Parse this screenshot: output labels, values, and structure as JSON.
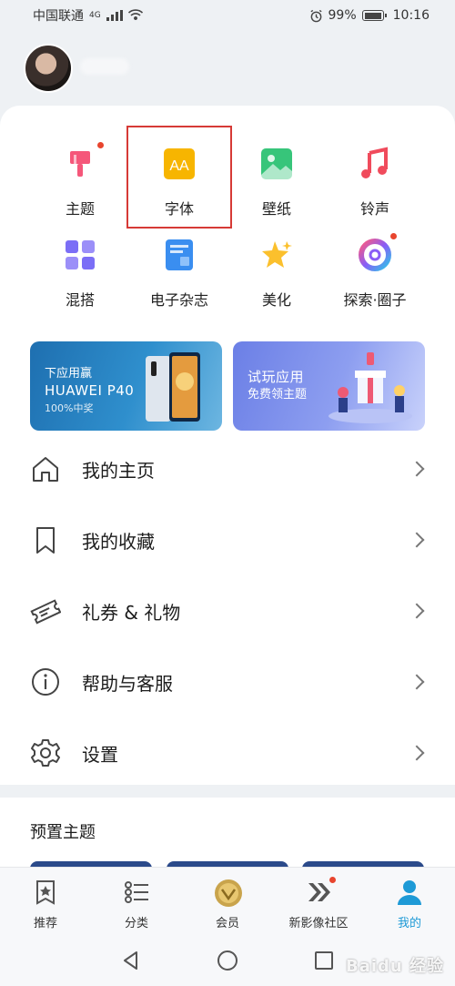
{
  "status_bar": {
    "carrier": "中国联通",
    "network": "4G",
    "battery": "99%",
    "time": "10:16"
  },
  "grid": {
    "items": [
      {
        "label": "主题",
        "icon": "brush-icon"
      },
      {
        "label": "字体",
        "icon": "font-icon"
      },
      {
        "label": "壁纸",
        "icon": "wallpaper-icon"
      },
      {
        "label": "铃声",
        "icon": "music-note-icon"
      },
      {
        "label": "混搭",
        "icon": "mix-grid-icon"
      },
      {
        "label": "电子杂志",
        "icon": "magazine-icon"
      },
      {
        "label": "美化",
        "icon": "star-icon"
      },
      {
        "label": "探索·圈子",
        "icon": "explore-circle-icon"
      }
    ]
  },
  "banners": {
    "left": {
      "line1": "下应用赢",
      "line2": "HUAWEI P40",
      "line3": "100%中奖"
    },
    "right": {
      "line1": "试玩应用",
      "line2": "免费领主题"
    }
  },
  "menu": {
    "items": [
      {
        "label": "我的主页",
        "icon": "home-icon"
      },
      {
        "label": "我的收藏",
        "icon": "bookmark-icon"
      },
      {
        "label": "礼券 & 礼物",
        "icon": "ticket-icon"
      },
      {
        "label": "帮助与客服",
        "icon": "info-icon"
      },
      {
        "label": "设置",
        "icon": "gear-icon"
      }
    ]
  },
  "preset_section": {
    "title": "预置主题"
  },
  "tabbar": {
    "items": [
      {
        "label": "推荐",
        "icon": "star-bookmark-icon"
      },
      {
        "label": "分类",
        "icon": "list-icon"
      },
      {
        "label": "会员",
        "icon": "vip-badge-icon"
      },
      {
        "label": "新影像社区",
        "icon": "chevrons-icon"
      },
      {
        "label": "我的",
        "icon": "person-icon"
      }
    ],
    "active": "我的"
  },
  "watermark": "Baidu 经验",
  "colors": {
    "accent": "#1e9ad6",
    "highlight_border": "#d63a36",
    "badge": "#e8452e"
  }
}
